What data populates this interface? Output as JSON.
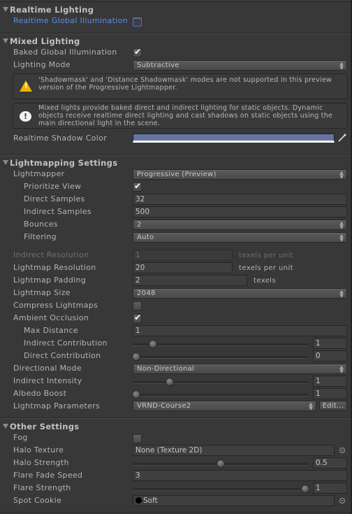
{
  "colors": {
    "background": "#383838",
    "link": "#5a8ef2",
    "shadow_color": "#6575a0",
    "warning": "#f0b400"
  },
  "realtime_lighting": {
    "title": "Realtime Lighting",
    "realtime_gi_label": "Realtime Global Illumination",
    "realtime_gi_checked": false
  },
  "mixed_lighting": {
    "title": "Mixed Lighting",
    "baked_gi_label": "Baked Global Illumination",
    "baked_gi_checked": true,
    "lighting_mode_label": "Lighting Mode",
    "lighting_mode_value": "Subtractive",
    "warning_icon": "warning-icon",
    "warning_line1": "'Shadowmask' and 'Distance Shadowmask' modes are not supported in this preview",
    "warning_line2": "version of the Progressive Lightmapper.",
    "info_icon": "info-icon",
    "info_line1": "Mixed lights provide baked direct and indirect lighting for static objects. Dynamic",
    "info_line2": "objects receive realtime direct lighting and cast shadows on static objects using the",
    "info_line3": "main directional light in the scene.",
    "shadow_color_label": "Realtime Shadow Color",
    "shadow_color_value": "#6575a0"
  },
  "lightmapping": {
    "title": "Lightmapping Settings",
    "lightmapper_label": "Lightmapper",
    "lightmapper_value": "Progressive (Preview)",
    "prioritize_view_label": "Prioritize View",
    "prioritize_view_checked": true,
    "direct_samples_label": "Direct Samples",
    "direct_samples_value": "32",
    "indirect_samples_label": "Indirect Samples",
    "indirect_samples_value": "500",
    "bounces_label": "Bounces",
    "bounces_value": "2",
    "filtering_label": "Filtering",
    "filtering_value": "Auto",
    "indirect_resolution_label": "Indirect Resolution",
    "indirect_resolution_value": "1",
    "indirect_resolution_unit": "texels per unit",
    "lightmap_resolution_label": "Lightmap Resolution",
    "lightmap_resolution_value": "20",
    "lightmap_resolution_unit": "texels per unit",
    "lightmap_padding_label": "Lightmap Padding",
    "lightmap_padding_value": "2",
    "lightmap_padding_unit": "texels",
    "lightmap_size_label": "Lightmap Size",
    "lightmap_size_value": "2048",
    "compress_label": "Compress Lightmaps",
    "compress_checked": false,
    "ao_label": "Ambient Occlusion",
    "ao_checked": true,
    "max_distance_label": "Max Distance",
    "max_distance_value": "1",
    "indirect_contribution_label": "Indirect Contribution",
    "indirect_contribution_value": "1",
    "indirect_contribution_fraction": 0.1,
    "direct_contribution_label": "Direct Contribution",
    "direct_contribution_value": "0",
    "direct_contribution_fraction": 0.0,
    "directional_mode_label": "Directional Mode",
    "directional_mode_value": "Non-Directional",
    "indirect_intensity_label": "Indirect Intensity",
    "indirect_intensity_value": "1",
    "indirect_intensity_fraction": 0.2,
    "albedo_boost_label": "Albedo Boost",
    "albedo_boost_value": "1",
    "albedo_boost_fraction": 0.0,
    "lightmap_params_label": "Lightmap Parameters",
    "lightmap_params_value": "VRND-Course2",
    "edit_button": "Edit..."
  },
  "other": {
    "title": "Other Settings",
    "fog_label": "Fog",
    "fog_checked": false,
    "halo_texture_label": "Halo Texture",
    "halo_texture_value": "None (Texture 2D)",
    "halo_strength_label": "Halo Strength",
    "halo_strength_value": "0.5",
    "halo_strength_fraction": 0.5,
    "flare_fade_label": "Flare Fade Speed",
    "flare_fade_value": "3",
    "flare_strength_label": "Flare Strength",
    "flare_strength_value": "1",
    "flare_strength_fraction": 1.0,
    "spot_cookie_label": "Spot Cookie",
    "spot_cookie_value": "Soft"
  }
}
